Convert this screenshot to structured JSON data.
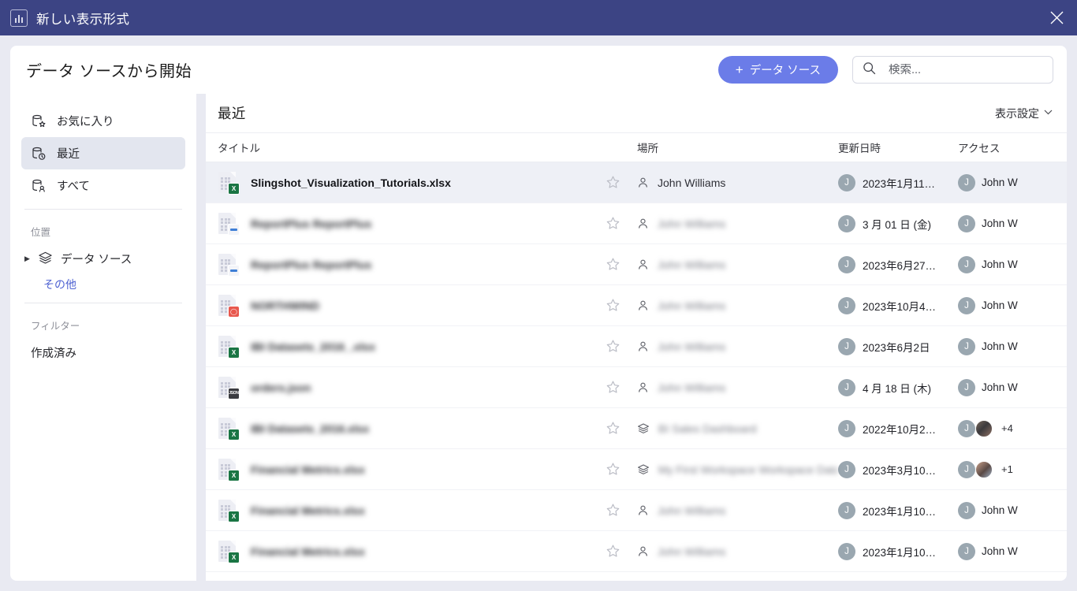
{
  "window": {
    "title": "新しい表示形式",
    "icon": "bar-chart-icon",
    "close_label": "✕"
  },
  "header": {
    "page_title": "データ ソースから開始",
    "add_button": {
      "label": "データ ソース",
      "plus": "+",
      "color": "#6b7ce8"
    },
    "search": {
      "placeholder": "検索...",
      "value": "",
      "icon": "search-icon"
    }
  },
  "sidebar": {
    "nav": [
      {
        "label": "お気に入り",
        "icon": "database-star-icon",
        "selected": false
      },
      {
        "label": "最近",
        "icon": "database-clock-icon",
        "selected": true
      },
      {
        "label": "すべて",
        "icon": "database-user-icon",
        "selected": false
      }
    ],
    "location_section": {
      "label": "位置"
    },
    "tree": [
      {
        "label": "データ ソース",
        "icon": "layers-icon",
        "expandable": true
      }
    ],
    "more_link": "その他",
    "filter_section": {
      "label": "フィルター"
    },
    "filters": [
      {
        "label": "作成済み"
      }
    ]
  },
  "content": {
    "heading": "最近",
    "view_settings": {
      "label": "表示設定",
      "chevron": "⌄"
    },
    "columns": {
      "title": "タイトル",
      "place": "場所",
      "updated": "更新日時",
      "access": "アクセス",
      "add": "+"
    },
    "rows": [
      {
        "title": "Slingshot_Visualization_Tutorials.xlsx",
        "redacted": false,
        "file_type": "excel",
        "badge_text": "X",
        "place": "John Williams",
        "place_redacted": false,
        "place_icon": "person-icon",
        "updated": "2023年1月11…",
        "updated_avatar": "J",
        "access": "John W",
        "access_avatar": "J",
        "extra_avatar": false,
        "extra_count": "",
        "selected": true
      },
      {
        "title": "ReportPlus ReportPlus",
        "redacted": true,
        "file_type": "db",
        "badge_text": "",
        "place": "John Williams",
        "place_redacted": true,
        "place_icon": "person-icon",
        "updated": "3 月 01 日 (金)",
        "updated_avatar": "J",
        "access": "John W",
        "access_avatar": "J",
        "extra_avatar": false,
        "extra_count": "",
        "selected": false
      },
      {
        "title": "ReportPlus ReportPlus",
        "redacted": true,
        "file_type": "db",
        "badge_text": "",
        "place": "John Williams",
        "place_redacted": true,
        "place_icon": "person-icon",
        "updated": "2023年6月27…",
        "updated_avatar": "J",
        "access": "John W",
        "access_avatar": "J",
        "extra_avatar": false,
        "extra_count": "",
        "selected": false
      },
      {
        "title": "NORTHWIND",
        "redacted": true,
        "file_type": "oracle",
        "badge_text": "",
        "place": "John Williams",
        "place_redacted": true,
        "place_icon": "person-icon",
        "updated": "2023年10月4…",
        "updated_avatar": "J",
        "access": "John W",
        "access_avatar": "J",
        "extra_avatar": false,
        "extra_count": "",
        "selected": false
      },
      {
        "title": "IBI Datasets_2016_.xlsx",
        "redacted": true,
        "file_type": "excel",
        "badge_text": "X",
        "place": "John Williams",
        "place_redacted": true,
        "place_icon": "person-icon",
        "updated": "2023年6月2日",
        "updated_avatar": "J",
        "access": "John W",
        "access_avatar": "J",
        "extra_avatar": false,
        "extra_count": "",
        "selected": false
      },
      {
        "title": "orders.json",
        "redacted": true,
        "file_type": "json",
        "badge_text": "JSON",
        "place": "John Williams",
        "place_redacted": true,
        "place_icon": "person-icon",
        "updated": "4 月 18 日 (木)",
        "updated_avatar": "J",
        "access": "John W",
        "access_avatar": "J",
        "extra_avatar": false,
        "extra_count": "",
        "selected": false
      },
      {
        "title": "IBI Datasets_2016.xlsx",
        "redacted": true,
        "file_type": "excel",
        "badge_text": "X",
        "place": "BI Sales Dashboard",
        "place_redacted": true,
        "place_icon": "layers-icon",
        "updated": "2022年10月2…",
        "updated_avatar": "J",
        "access": "",
        "access_avatar": "J",
        "extra_avatar": true,
        "extra_count": "+4",
        "selected": false
      },
      {
        "title": "Financial Metrics.xlsx",
        "redacted": true,
        "file_type": "excel",
        "badge_text": "X",
        "place": "My First Workspace Workspace Data So",
        "place_redacted": true,
        "place_icon": "layers-icon",
        "updated": "2023年3月10…",
        "updated_avatar": "J",
        "access": "",
        "access_avatar": "J",
        "extra_avatar": true,
        "extra_count": "+1",
        "selected": false
      },
      {
        "title": "Financial Metrics.xlsx",
        "redacted": true,
        "file_type": "excel",
        "badge_text": "X",
        "place": "John Williams",
        "place_redacted": true,
        "place_icon": "person-icon",
        "updated": "2023年1月10…",
        "updated_avatar": "J",
        "access": "John W",
        "access_avatar": "J",
        "extra_avatar": false,
        "extra_count": "",
        "selected": false
      },
      {
        "title": "Financial Metrics.xlsx",
        "redacted": true,
        "file_type": "excel",
        "badge_text": "X",
        "place": "John Williams",
        "place_redacted": true,
        "place_icon": "person-icon",
        "updated": "2023年1月10…",
        "updated_avatar": "J",
        "access": "John W",
        "access_avatar": "J",
        "extra_avatar": false,
        "extra_count": "",
        "selected": false
      }
    ]
  }
}
